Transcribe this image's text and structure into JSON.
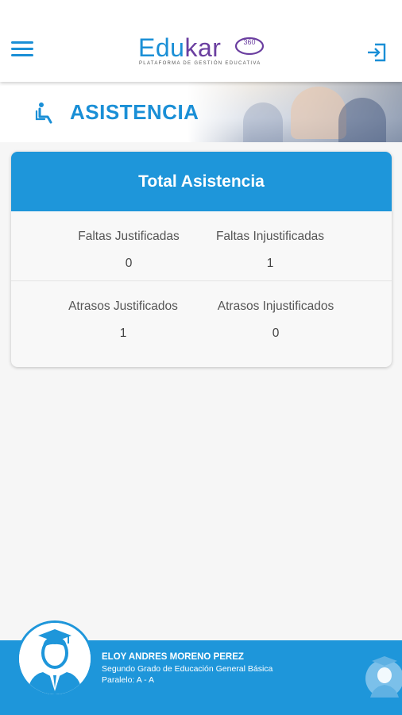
{
  "header": {
    "logo_text_a": "Edu",
    "logo_text_b": "kar",
    "logo_badge": "360",
    "logo_subtitle": "PLATAFORMA DE GESTIÓN EDUCATIVA",
    "menu_icon": "hamburger-menu-icon",
    "logout_icon": "logout-icon"
  },
  "section": {
    "title": "ASISTENCIA",
    "icon": "wheelchair-seat-icon"
  },
  "attendance": {
    "title": "Total Asistencia",
    "faltas_justificadas_label": "Faltas Justificadas",
    "faltas_justificadas_value": "0",
    "faltas_injustificadas_label": "Faltas Injustificadas",
    "faltas_injustificadas_value": "1",
    "atrasos_justificados_label": "Atrasos Justificados",
    "atrasos_justificados_value": "1",
    "atrasos_injustificados_label": "Atrasos Injustificados",
    "atrasos_injustificados_value": "0"
  },
  "student": {
    "name": "ELOY ANDRES MORENO PEREZ",
    "grade": "Segundo Grado de Educación General Básica",
    "paralelo": "Paralelo: A - A"
  },
  "colors": {
    "primary": "#1e96da",
    "logo_purple": "#6b3fa0"
  }
}
